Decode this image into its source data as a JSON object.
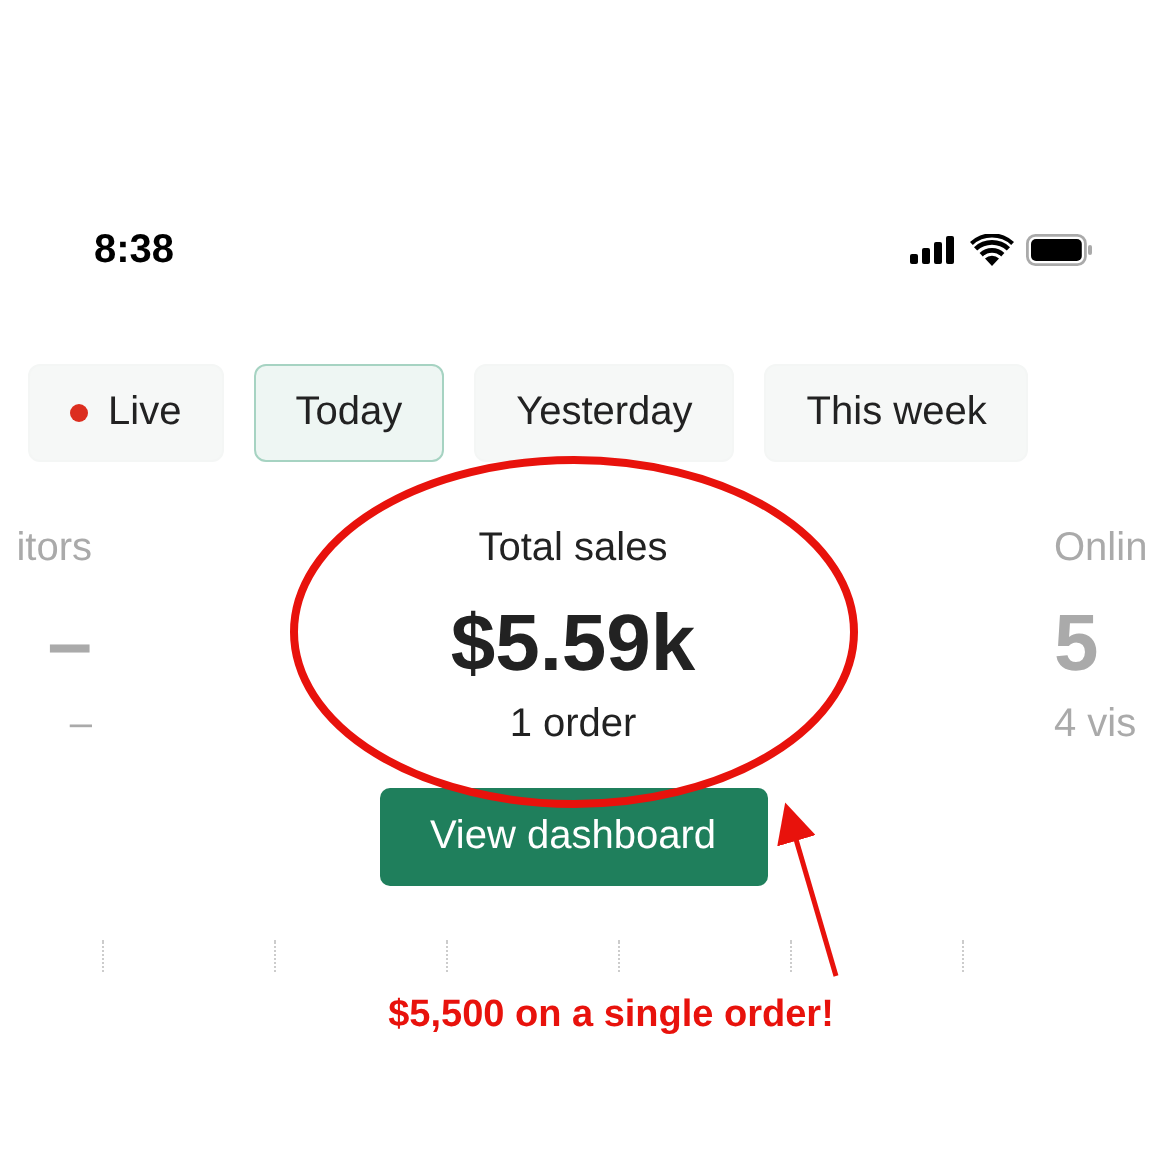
{
  "status_bar": {
    "time": "8:38"
  },
  "tabs": [
    {
      "label": "Live",
      "kind": "live",
      "selected": false
    },
    {
      "label": "Today",
      "kind": "plain",
      "selected": true
    },
    {
      "label": "Yesterday",
      "kind": "plain",
      "selected": false
    },
    {
      "label": "This week",
      "kind": "plain",
      "selected": false
    }
  ],
  "stats": [
    {
      "kind": "left",
      "title": "itors",
      "value": "–",
      "sub": "–"
    },
    {
      "kind": "center",
      "title": "Total sales",
      "value": "$5.59k",
      "sub": "1 order"
    },
    {
      "kind": "right",
      "title": "Onlin",
      "value": "5",
      "sub": "4 vis"
    }
  ],
  "button": {
    "label": "View dashboard"
  },
  "annotation": {
    "text": "$5,500 on a single order!"
  }
}
